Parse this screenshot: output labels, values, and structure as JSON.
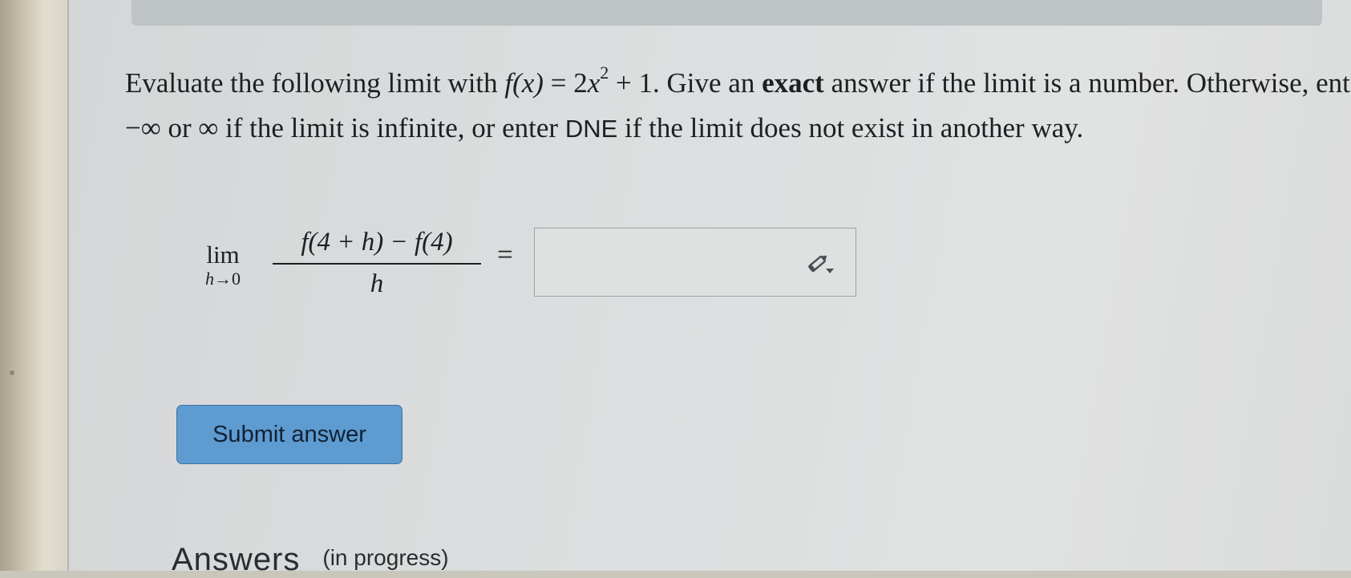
{
  "question": {
    "p1": "Evaluate the following limit with ",
    "fx": "f(x)",
    "eq": " = 2",
    "x": "x",
    "exp": "2",
    "plus": " + 1. Give an ",
    "exact": "exact",
    "p2": " answer if the limit is a number. Otherwise, enter −∞ or ∞ if the limit is infinite, or enter ",
    "dne": "DNE",
    "p3": " if the limit does not exist in another way."
  },
  "limit": {
    "lim": "lim",
    "sub_var": "h",
    "sub_rest": "→0",
    "numerator": "f(4 + h) − f(4)",
    "denominator": "h",
    "equals": "="
  },
  "answer_input": {
    "value": "",
    "icon": "pencil-icon"
  },
  "submit_label": "Submit answer",
  "answers": {
    "title": "Answers",
    "status": "(in progress)"
  },
  "colors": {
    "button": "#5d9bd0",
    "screen": "#dcdedf",
    "text": "#1d1f22"
  }
}
